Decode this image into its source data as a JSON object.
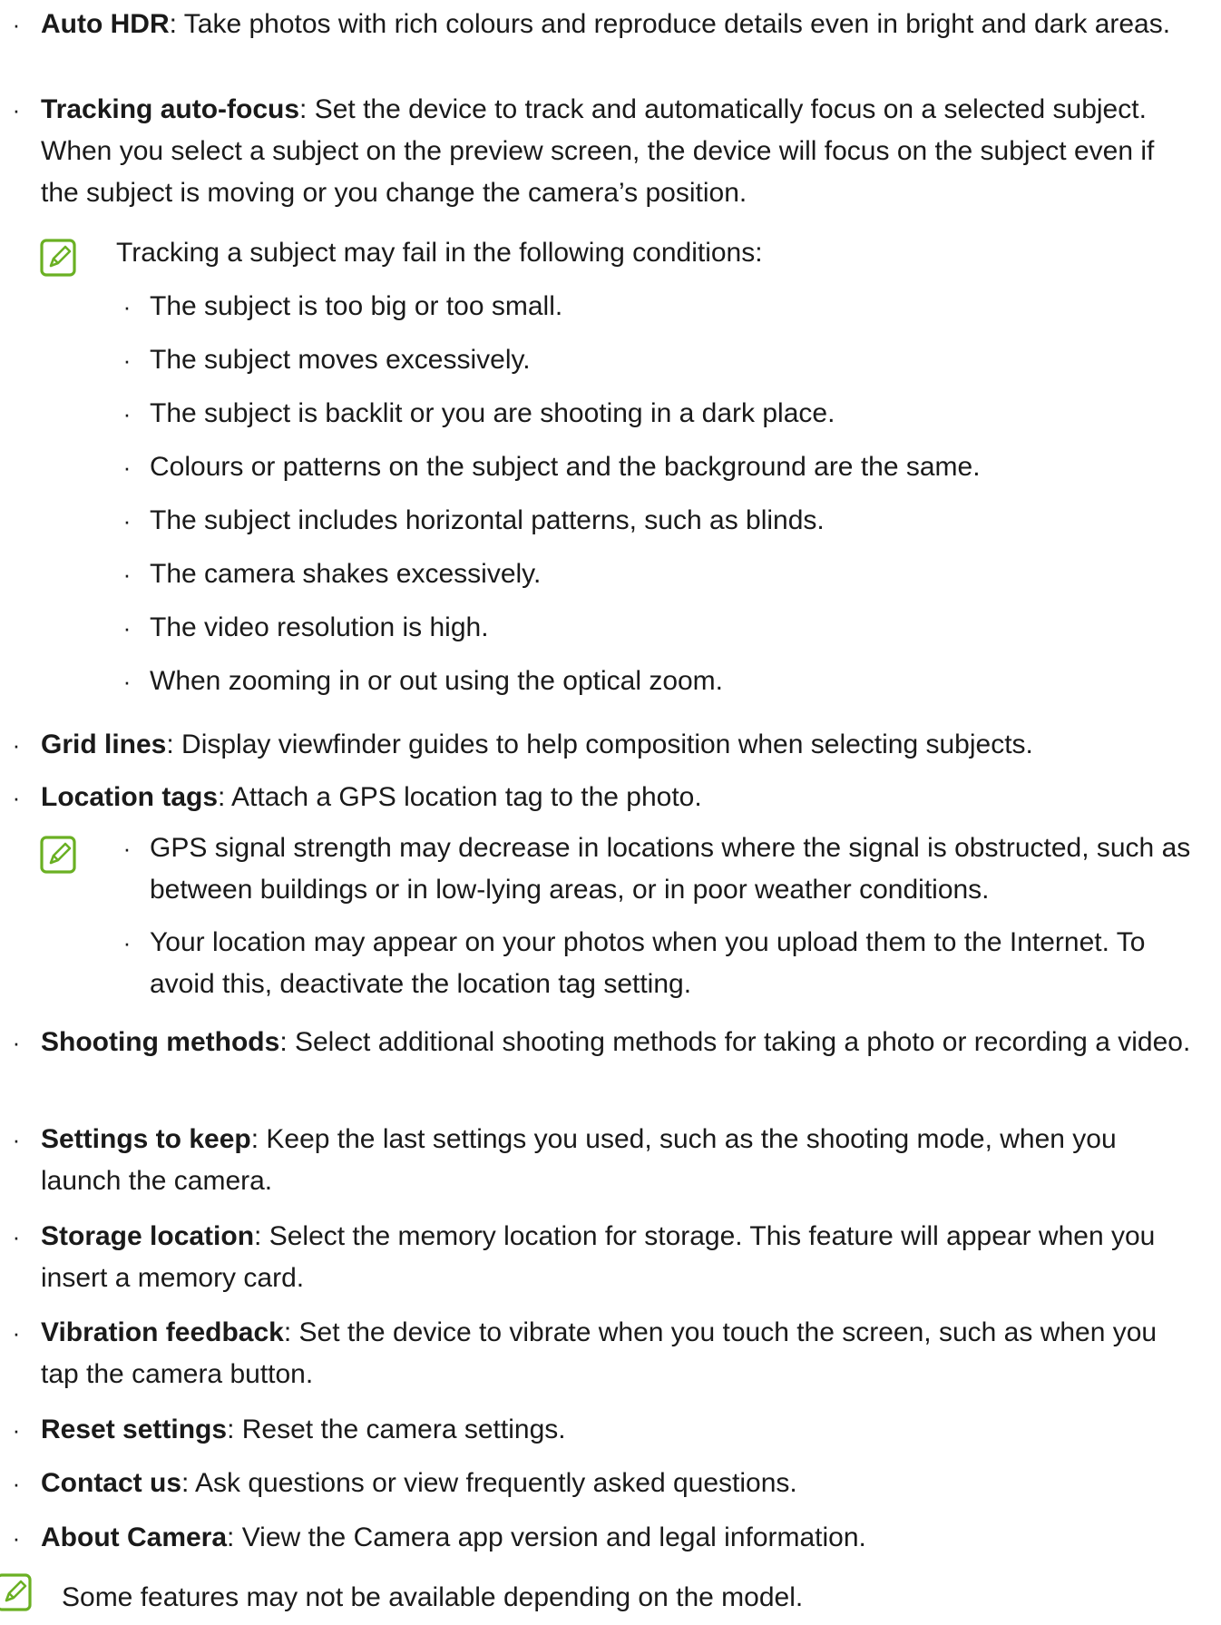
{
  "bullet_glyph": "·",
  "accent_color": "#6ab023",
  "items": [
    {
      "term": "Auto HDR",
      "sep": ": ",
      "text": "Take photos with rich colours and reproduce details even in bright and dark areas."
    },
    {
      "term": "Tracking auto-focus",
      "sep": ": ",
      "text": "Set the device to track and automatically focus on a selected subject. When you select a subject on the preview screen, the device will focus on the subject even if the subject is moving or you change the camera’s position."
    },
    {
      "term": "Grid lines",
      "sep": ": ",
      "text": "Display viewfinder guides to help composition when selecting subjects."
    },
    {
      "term": "Location tags",
      "sep": ": ",
      "text": "Attach a GPS location tag to the photo."
    },
    {
      "term": "Shooting methods",
      "sep": ": ",
      "text": "Select additional shooting methods for taking a photo or recording a video."
    },
    {
      "term": "Settings to keep",
      "sep": ": ",
      "text": "Keep the last settings you used, such as the shooting mode, when you launch the camera."
    },
    {
      "term": "Storage location",
      "sep": ": ",
      "text": "Select the memory location for storage. This feature will appear when you insert a memory card."
    },
    {
      "term": "Vibration feedback",
      "sep": ": ",
      "text": "Set the device to vibrate when you touch the screen, such as when you tap the camera button."
    },
    {
      "term": "Reset settings",
      "sep": ": ",
      "text": "Reset the camera settings."
    },
    {
      "term": "Contact us",
      "sep": ": ",
      "text": "Ask questions or view frequently asked questions."
    },
    {
      "term": "About Camera",
      "sep": ": ",
      "text": "View the Camera app version and legal information."
    }
  ],
  "tracking_note": {
    "intro": "Tracking a subject may fail in the following conditions:",
    "conditions": [
      "The subject is too big or too small.",
      "The subject moves excessively.",
      "The subject is backlit or you are shooting in a dark place.",
      "Colours or patterns on the subject and the background are the same.",
      "The subject includes horizontal patterns, such as blinds.",
      "The camera shakes excessively.",
      "The video resolution is high.",
      "When zooming in or out using the optical zoom."
    ]
  },
  "location_note": {
    "points": [
      "GPS signal strength may decrease in locations where the signal is obstructed, such as between buildings or in low-lying areas, or in poor weather conditions.",
      "Your location may appear on your photos when you upload them to the Internet. To avoid this, deactivate the location tag setting."
    ]
  },
  "footer_note": "Some features may not be available depending on the model."
}
